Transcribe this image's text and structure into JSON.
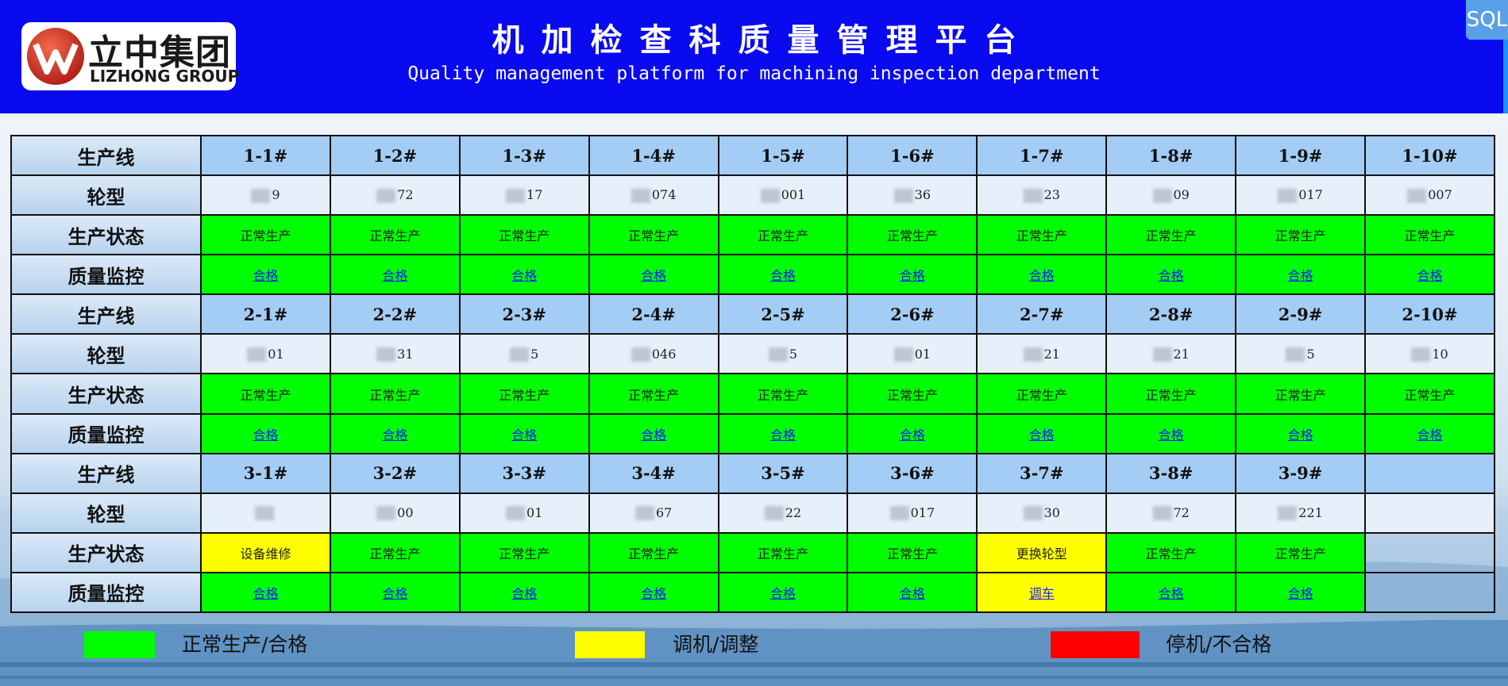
{
  "header": {
    "logo_cn": "立中集团",
    "logo_en": "LIZHONG GROUP",
    "title_cn": "机加检查科质量管理平台",
    "title_en": "Quality management platform for machining inspection department",
    "sql_button": "SQL"
  },
  "labels": {
    "line": "生产线",
    "wheel": "轮型",
    "status": "生产状态",
    "quality": "质量监控"
  },
  "groups": [
    {
      "lines": [
        "1-1#",
        "1-2#",
        "1-3#",
        "1-4#",
        "1-5#",
        "1-6#",
        "1-7#",
        "1-8#",
        "1-9#",
        "1-10#"
      ],
      "wheels": [
        "9",
        "72",
        "17",
        "074",
        "001",
        "36",
        "23",
        "09",
        "017",
        "007"
      ],
      "status": [
        "正常生产",
        "正常生产",
        "正常生产",
        "正常生产",
        "正常生产",
        "正常生产",
        "正常生产",
        "正常生产",
        "正常生产",
        "正常生产"
      ],
      "status_color": [
        "green",
        "green",
        "green",
        "green",
        "green",
        "green",
        "green",
        "green",
        "green",
        "green"
      ],
      "quality": [
        "合格",
        "合格",
        "合格",
        "合格",
        "合格",
        "合格",
        "合格",
        "合格",
        "合格",
        "合格"
      ],
      "quality_color": [
        "green",
        "green",
        "green",
        "green",
        "green",
        "green",
        "green",
        "green",
        "green",
        "green"
      ]
    },
    {
      "lines": [
        "2-1#",
        "2-2#",
        "2-3#",
        "2-4#",
        "2-5#",
        "2-6#",
        "2-7#",
        "2-8#",
        "2-9#",
        "2-10#"
      ],
      "wheels": [
        "01",
        "31",
        "5",
        "046",
        "5",
        "01",
        "21",
        "21",
        "5",
        "10"
      ],
      "status": [
        "正常生产",
        "正常生产",
        "正常生产",
        "正常生产",
        "正常生产",
        "正常生产",
        "正常生产",
        "正常生产",
        "正常生产",
        "正常生产"
      ],
      "status_color": [
        "green",
        "green",
        "green",
        "green",
        "green",
        "green",
        "green",
        "green",
        "green",
        "green"
      ],
      "quality": [
        "合格",
        "合格",
        "合格",
        "合格",
        "合格",
        "合格",
        "合格",
        "合格",
        "合格",
        "合格"
      ],
      "quality_color": [
        "green",
        "green",
        "green",
        "green",
        "green",
        "green",
        "green",
        "green",
        "green",
        "green"
      ]
    },
    {
      "lines": [
        "3-1#",
        "3-2#",
        "3-3#",
        "3-4#",
        "3-5#",
        "3-6#",
        "3-7#",
        "3-8#",
        "3-9#",
        ""
      ],
      "wheels": [
        "",
        "00",
        "01",
        "67",
        "22",
        "017",
        "30",
        "72",
        "221",
        ""
      ],
      "status": [
        "设备维修",
        "正常生产",
        "正常生产",
        "正常生产",
        "正常生产",
        "正常生产",
        "更换轮型",
        "正常生产",
        "正常生产",
        ""
      ],
      "status_color": [
        "yellow",
        "green",
        "green",
        "green",
        "green",
        "green",
        "yellow",
        "green",
        "green",
        "empty"
      ],
      "quality": [
        "合格",
        "合格",
        "合格",
        "合格",
        "合格",
        "合格",
        "调车",
        "合格",
        "合格",
        ""
      ],
      "quality_color": [
        "green",
        "green",
        "green",
        "green",
        "green",
        "green",
        "yellow",
        "green",
        "green",
        "empty"
      ]
    }
  ],
  "legend": [
    {
      "label": "正常生产/合格",
      "color": "#00ff00"
    },
    {
      "label": "调机/调整",
      "color": "#ffff00"
    },
    {
      "label": "停机/不合格",
      "color": "#ff0000"
    }
  ]
}
